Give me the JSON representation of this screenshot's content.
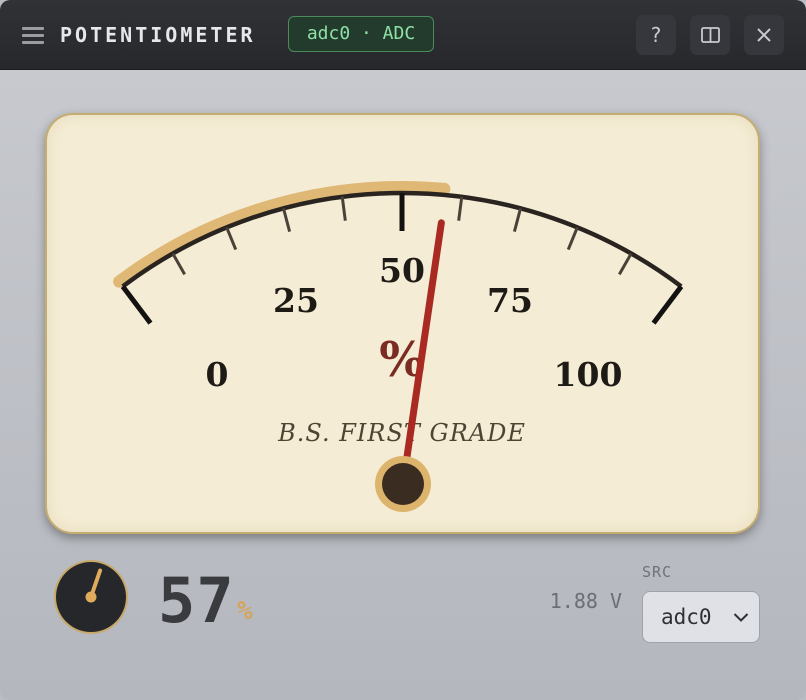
{
  "window": {
    "title": "POTENTIOMETER",
    "badge": "adc0 · ADC",
    "buttons": {
      "help": "?",
      "split": "◫",
      "close": "✕"
    }
  },
  "gauge": {
    "scale_min": 0,
    "scale_max": 100,
    "major_ticks": [
      0,
      25,
      50,
      75,
      100
    ],
    "unit": "%",
    "caption": "B.S. FIRST GRADE",
    "needle_value": 57,
    "colors": {
      "arc": "#2a2420",
      "highlight": "#ddb36a",
      "needle": "#a82a22",
      "unit": "#7a2b22",
      "face": "#f4ecd4"
    }
  },
  "readout": {
    "value": "57",
    "unit": "%",
    "voltage": "1.88 V",
    "knob_level_percent": 57
  },
  "source": {
    "label": "SRC",
    "selected": "adc0"
  },
  "icons": [
    "hamburger-menu-icon",
    "help-icon",
    "split-view-icon",
    "close-icon",
    "chevron-down-icon",
    "knob-icon"
  ]
}
